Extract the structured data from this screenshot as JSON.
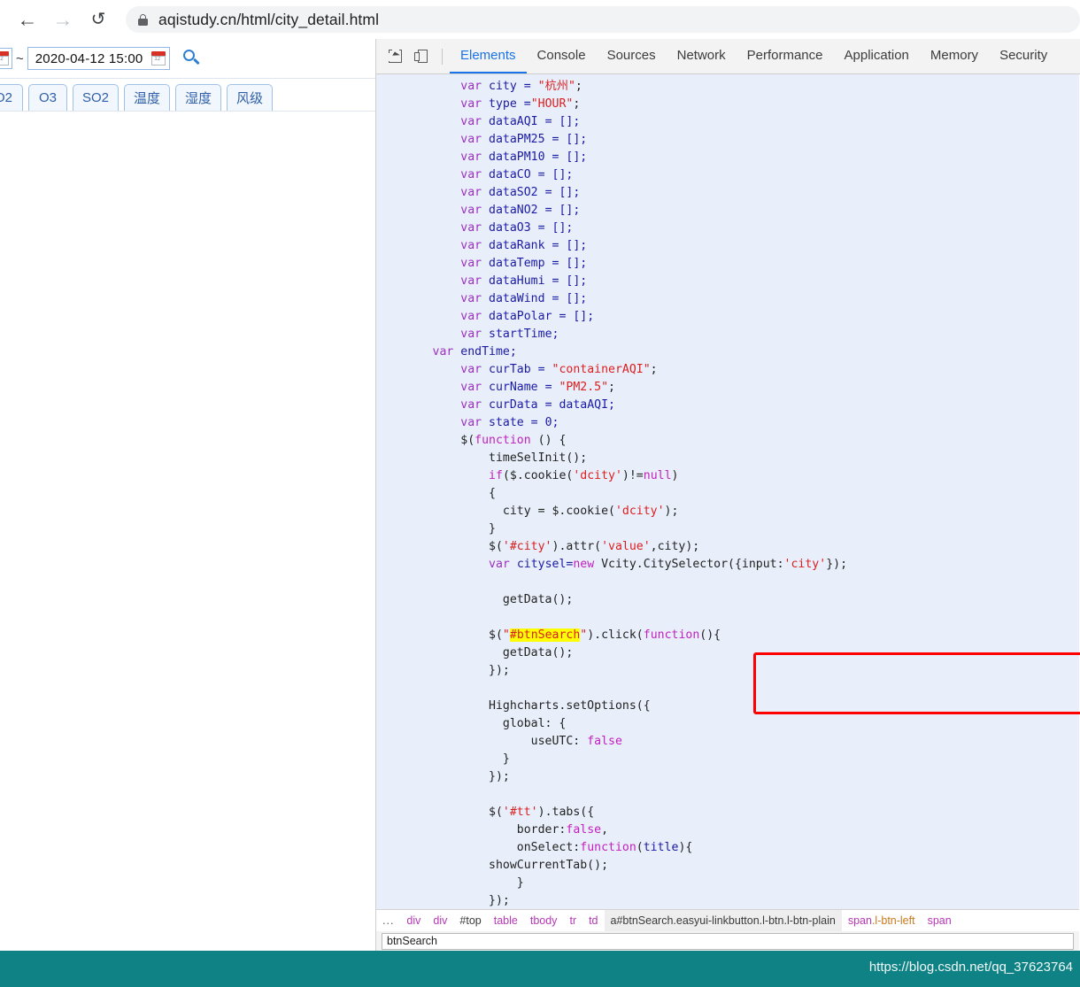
{
  "browser": {
    "back_icon": "arrow-left-icon",
    "forward_icon": "arrow-right-icon",
    "reload_icon": "reload-icon",
    "lock_icon": "lock-icon",
    "url": "aqistudy.cn/html/city_detail.html"
  },
  "page": {
    "date_range_separator": "~",
    "date_value": "2020-04-12 15:00",
    "start_calendar_icon": "calendar-icon",
    "end_calendar_icon": "calendar-icon",
    "search_icon": "search-icon",
    "tabs": [
      {
        "label": "O2"
      },
      {
        "label": "O3"
      },
      {
        "label": "SO2"
      },
      {
        "label": "温度"
      },
      {
        "label": "湿度"
      },
      {
        "label": "风级"
      }
    ]
  },
  "devtools": {
    "inspect_icon": "inspect-element-icon",
    "device_icon": "device-toolbar-icon",
    "tabs": [
      {
        "label": "Elements",
        "active": true
      },
      {
        "label": "Console",
        "active": false
      },
      {
        "label": "Sources",
        "active": false
      },
      {
        "label": "Network",
        "active": false
      },
      {
        "label": "Performance",
        "active": false
      },
      {
        "label": "Application",
        "active": false
      },
      {
        "label": "Memory",
        "active": false
      },
      {
        "label": "Security",
        "active": false
      }
    ],
    "code_lines": [
      [
        {
          "t": "            ",
          "c": "plain"
        },
        {
          "t": "var",
          "c": "kw"
        },
        {
          "t": " city = ",
          "c": "var"
        },
        {
          "t": "\"杭州\"",
          "c": "str"
        },
        {
          "t": ";",
          "c": "plain"
        }
      ],
      [
        {
          "t": "            ",
          "c": "plain"
        },
        {
          "t": "var",
          "c": "kw"
        },
        {
          "t": " type =",
          "c": "var"
        },
        {
          "t": "\"HOUR\"",
          "c": "str"
        },
        {
          "t": ";",
          "c": "plain"
        }
      ],
      [
        {
          "t": "            ",
          "c": "plain"
        },
        {
          "t": "var",
          "c": "kw"
        },
        {
          "t": " dataAQI = [];",
          "c": "var"
        }
      ],
      [
        {
          "t": "            ",
          "c": "plain"
        },
        {
          "t": "var",
          "c": "kw"
        },
        {
          "t": " dataPM25 = [];",
          "c": "var"
        }
      ],
      [
        {
          "t": "            ",
          "c": "plain"
        },
        {
          "t": "var",
          "c": "kw"
        },
        {
          "t": " dataPM10 = [];",
          "c": "var"
        }
      ],
      [
        {
          "t": "            ",
          "c": "plain"
        },
        {
          "t": "var",
          "c": "kw"
        },
        {
          "t": " dataCO = [];",
          "c": "var"
        }
      ],
      [
        {
          "t": "            ",
          "c": "plain"
        },
        {
          "t": "var",
          "c": "kw"
        },
        {
          "t": " dataSO2 = [];",
          "c": "var"
        }
      ],
      [
        {
          "t": "            ",
          "c": "plain"
        },
        {
          "t": "var",
          "c": "kw"
        },
        {
          "t": " dataNO2 = [];",
          "c": "var"
        }
      ],
      [
        {
          "t": "            ",
          "c": "plain"
        },
        {
          "t": "var",
          "c": "kw"
        },
        {
          "t": " dataO3 = [];",
          "c": "var"
        }
      ],
      [
        {
          "t": "            ",
          "c": "plain"
        },
        {
          "t": "var",
          "c": "kw"
        },
        {
          "t": " dataRank = [];",
          "c": "var"
        }
      ],
      [
        {
          "t": "            ",
          "c": "plain"
        },
        {
          "t": "var",
          "c": "kw"
        },
        {
          "t": " dataTemp = [];",
          "c": "var"
        }
      ],
      [
        {
          "t": "            ",
          "c": "plain"
        },
        {
          "t": "var",
          "c": "kw"
        },
        {
          "t": " dataHumi = [];",
          "c": "var"
        }
      ],
      [
        {
          "t": "            ",
          "c": "plain"
        },
        {
          "t": "var",
          "c": "kw"
        },
        {
          "t": " dataWind = [];",
          "c": "var"
        }
      ],
      [
        {
          "t": "            ",
          "c": "plain"
        },
        {
          "t": "var",
          "c": "kw"
        },
        {
          "t": " dataPolar = [];",
          "c": "var"
        }
      ],
      [
        {
          "t": "            ",
          "c": "plain"
        },
        {
          "t": "var",
          "c": "kw"
        },
        {
          "t": " startTime;",
          "c": "var"
        }
      ],
      [
        {
          "t": "        ",
          "c": "plain"
        },
        {
          "t": "var",
          "c": "kw"
        },
        {
          "t": " endTime;",
          "c": "var"
        }
      ],
      [
        {
          "t": "            ",
          "c": "plain"
        },
        {
          "t": "var",
          "c": "kw"
        },
        {
          "t": " curTab = ",
          "c": "var"
        },
        {
          "t": "\"containerAQI\"",
          "c": "str"
        },
        {
          "t": ";",
          "c": "plain"
        }
      ],
      [
        {
          "t": "            ",
          "c": "plain"
        },
        {
          "t": "var",
          "c": "kw"
        },
        {
          "t": " curName = ",
          "c": "var"
        },
        {
          "t": "\"PM2.5\"",
          "c": "str"
        },
        {
          "t": ";",
          "c": "plain"
        }
      ],
      [
        {
          "t": "            ",
          "c": "plain"
        },
        {
          "t": "var",
          "c": "kw"
        },
        {
          "t": " curData = dataAQI;",
          "c": "var"
        }
      ],
      [
        {
          "t": "            ",
          "c": "plain"
        },
        {
          "t": "var",
          "c": "kw"
        },
        {
          "t": " state = 0;",
          "c": "var"
        }
      ],
      [
        {
          "t": "            $(",
          "c": "plain"
        },
        {
          "t": "function",
          "c": "kw2"
        },
        {
          "t": " () {",
          "c": "plain"
        }
      ],
      [
        {
          "t": "                timeSelInit();",
          "c": "plain"
        }
      ],
      [
        {
          "t": "                ",
          "c": "plain"
        },
        {
          "t": "if",
          "c": "kw2"
        },
        {
          "t": "($.cookie(",
          "c": "plain"
        },
        {
          "t": "'dcity'",
          "c": "str"
        },
        {
          "t": ")!=",
          "c": "plain"
        },
        {
          "t": "null",
          "c": "kw2"
        },
        {
          "t": ")",
          "c": "plain"
        }
      ],
      [
        {
          "t": "                {",
          "c": "plain"
        }
      ],
      [
        {
          "t": "                  city = $.cookie(",
          "c": "plain"
        },
        {
          "t": "'dcity'",
          "c": "str"
        },
        {
          "t": ");",
          "c": "plain"
        }
      ],
      [
        {
          "t": "                }",
          "c": "plain"
        }
      ],
      [
        {
          "t": "                $(",
          "c": "plain"
        },
        {
          "t": "'#city'",
          "c": "str"
        },
        {
          "t": ").attr(",
          "c": "plain"
        },
        {
          "t": "'value'",
          "c": "str"
        },
        {
          "t": ",city);",
          "c": "plain"
        }
      ],
      [
        {
          "t": "                ",
          "c": "plain"
        },
        {
          "t": "var",
          "c": "kw"
        },
        {
          "t": " citysel=",
          "c": "var"
        },
        {
          "t": "new",
          "c": "kw2"
        },
        {
          "t": " Vcity.CitySelector({input:",
          "c": "plain"
        },
        {
          "t": "'city'",
          "c": "str"
        },
        {
          "t": "});",
          "c": "plain"
        }
      ],
      [
        {
          "t": "",
          "c": "plain"
        }
      ],
      [
        {
          "t": "                  getData();",
          "c": "plain"
        }
      ],
      [
        {
          "t": "",
          "c": "plain"
        }
      ],
      [
        {
          "t": "                $(",
          "c": "plain"
        },
        {
          "t": "\"",
          "c": "str"
        },
        {
          "t": "#btnSearch",
          "c": "hl-str"
        },
        {
          "t": "\"",
          "c": "str"
        },
        {
          "t": ").click(",
          "c": "plain"
        },
        {
          "t": "function",
          "c": "kw2"
        },
        {
          "t": "(){",
          "c": "plain"
        }
      ],
      [
        {
          "t": "                  getData();",
          "c": "plain"
        }
      ],
      [
        {
          "t": "                });",
          "c": "plain"
        }
      ],
      [
        {
          "t": "",
          "c": "plain"
        }
      ],
      [
        {
          "t": "                Highcharts.setOptions({",
          "c": "plain"
        }
      ],
      [
        {
          "t": "                  global: {",
          "c": "plain"
        }
      ],
      [
        {
          "t": "                      useUTC: ",
          "c": "plain"
        },
        {
          "t": "false",
          "c": "kw2"
        }
      ],
      [
        {
          "t": "                  }",
          "c": "plain"
        }
      ],
      [
        {
          "t": "                });",
          "c": "plain"
        }
      ],
      [
        {
          "t": "",
          "c": "plain"
        }
      ],
      [
        {
          "t": "                $(",
          "c": "plain"
        },
        {
          "t": "'#tt'",
          "c": "str"
        },
        {
          "t": ").tabs({",
          "c": "plain"
        }
      ],
      [
        {
          "t": "                    border:",
          "c": "plain"
        },
        {
          "t": "false",
          "c": "kw2"
        },
        {
          "t": ",",
          "c": "plain"
        }
      ],
      [
        {
          "t": "                    onSelect:",
          "c": "plain"
        },
        {
          "t": "function",
          "c": "kw2"
        },
        {
          "t": "(",
          "c": "plain"
        },
        {
          "t": "title",
          "c": "var"
        },
        {
          "t": "){",
          "c": "plain"
        }
      ],
      [
        {
          "t": "                showCurrentTab();",
          "c": "plain"
        }
      ],
      [
        {
          "t": "                    }",
          "c": "plain"
        }
      ],
      [
        {
          "t": "                });",
          "c": "plain"
        }
      ]
    ],
    "highlight_token": "#btnSearch",
    "annotation": {
      "shape": "red-rectangle",
      "color": "#ff0000"
    },
    "breadcrumb": [
      {
        "text": "...",
        "kind": "dots"
      },
      {
        "text": "div",
        "kind": "tag"
      },
      {
        "text": "div",
        "kind": "tag"
      },
      {
        "text": "#top",
        "kind": "id"
      },
      {
        "text": "table",
        "kind": "tag"
      },
      {
        "text": "tbody",
        "kind": "tag"
      },
      {
        "text": "tr",
        "kind": "tag"
      },
      {
        "text": "td",
        "kind": "tag"
      },
      {
        "text": "a#btnSearch.easyui-linkbutton.l-btn.l-btn-plain",
        "kind": "selected"
      },
      {
        "text": "span",
        "cls": ".l-btn-left",
        "kind": "tag-cls"
      },
      {
        "text": "span",
        "kind": "tag"
      }
    ],
    "input_value": "btnSearch"
  },
  "footer": {
    "watermark": "https://blog.csdn.net/qq_37623764",
    "background": "#0e8284"
  }
}
